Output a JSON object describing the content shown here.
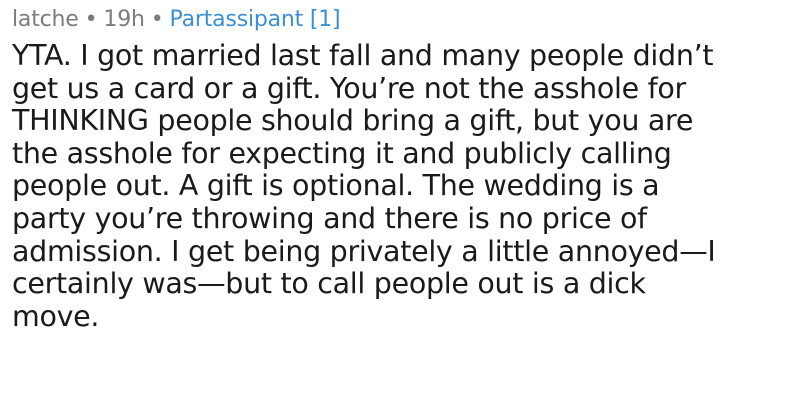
{
  "comment": {
    "username": "latche",
    "separator": "•",
    "age": "19h",
    "flair": "Partassipant [1]",
    "body_lines": [
      "YTA. I got married last fall and many people didn’t",
      "get us a card or a gift. You’re not the asshole for",
      "THINKING people should bring a gift, but you are",
      "the asshole for expecting it and publicly calling",
      "people out. A gift is optional. The wedding is a",
      "party you’re throwing and there is no price of",
      "admission. I get being privately a little annoyed—I",
      "certainly was—but to call people out is a dick",
      "move."
    ]
  },
  "colors": {
    "meta": "#7c7c7c",
    "flair": "#3b8fd4",
    "body": "#1a1a1a"
  }
}
